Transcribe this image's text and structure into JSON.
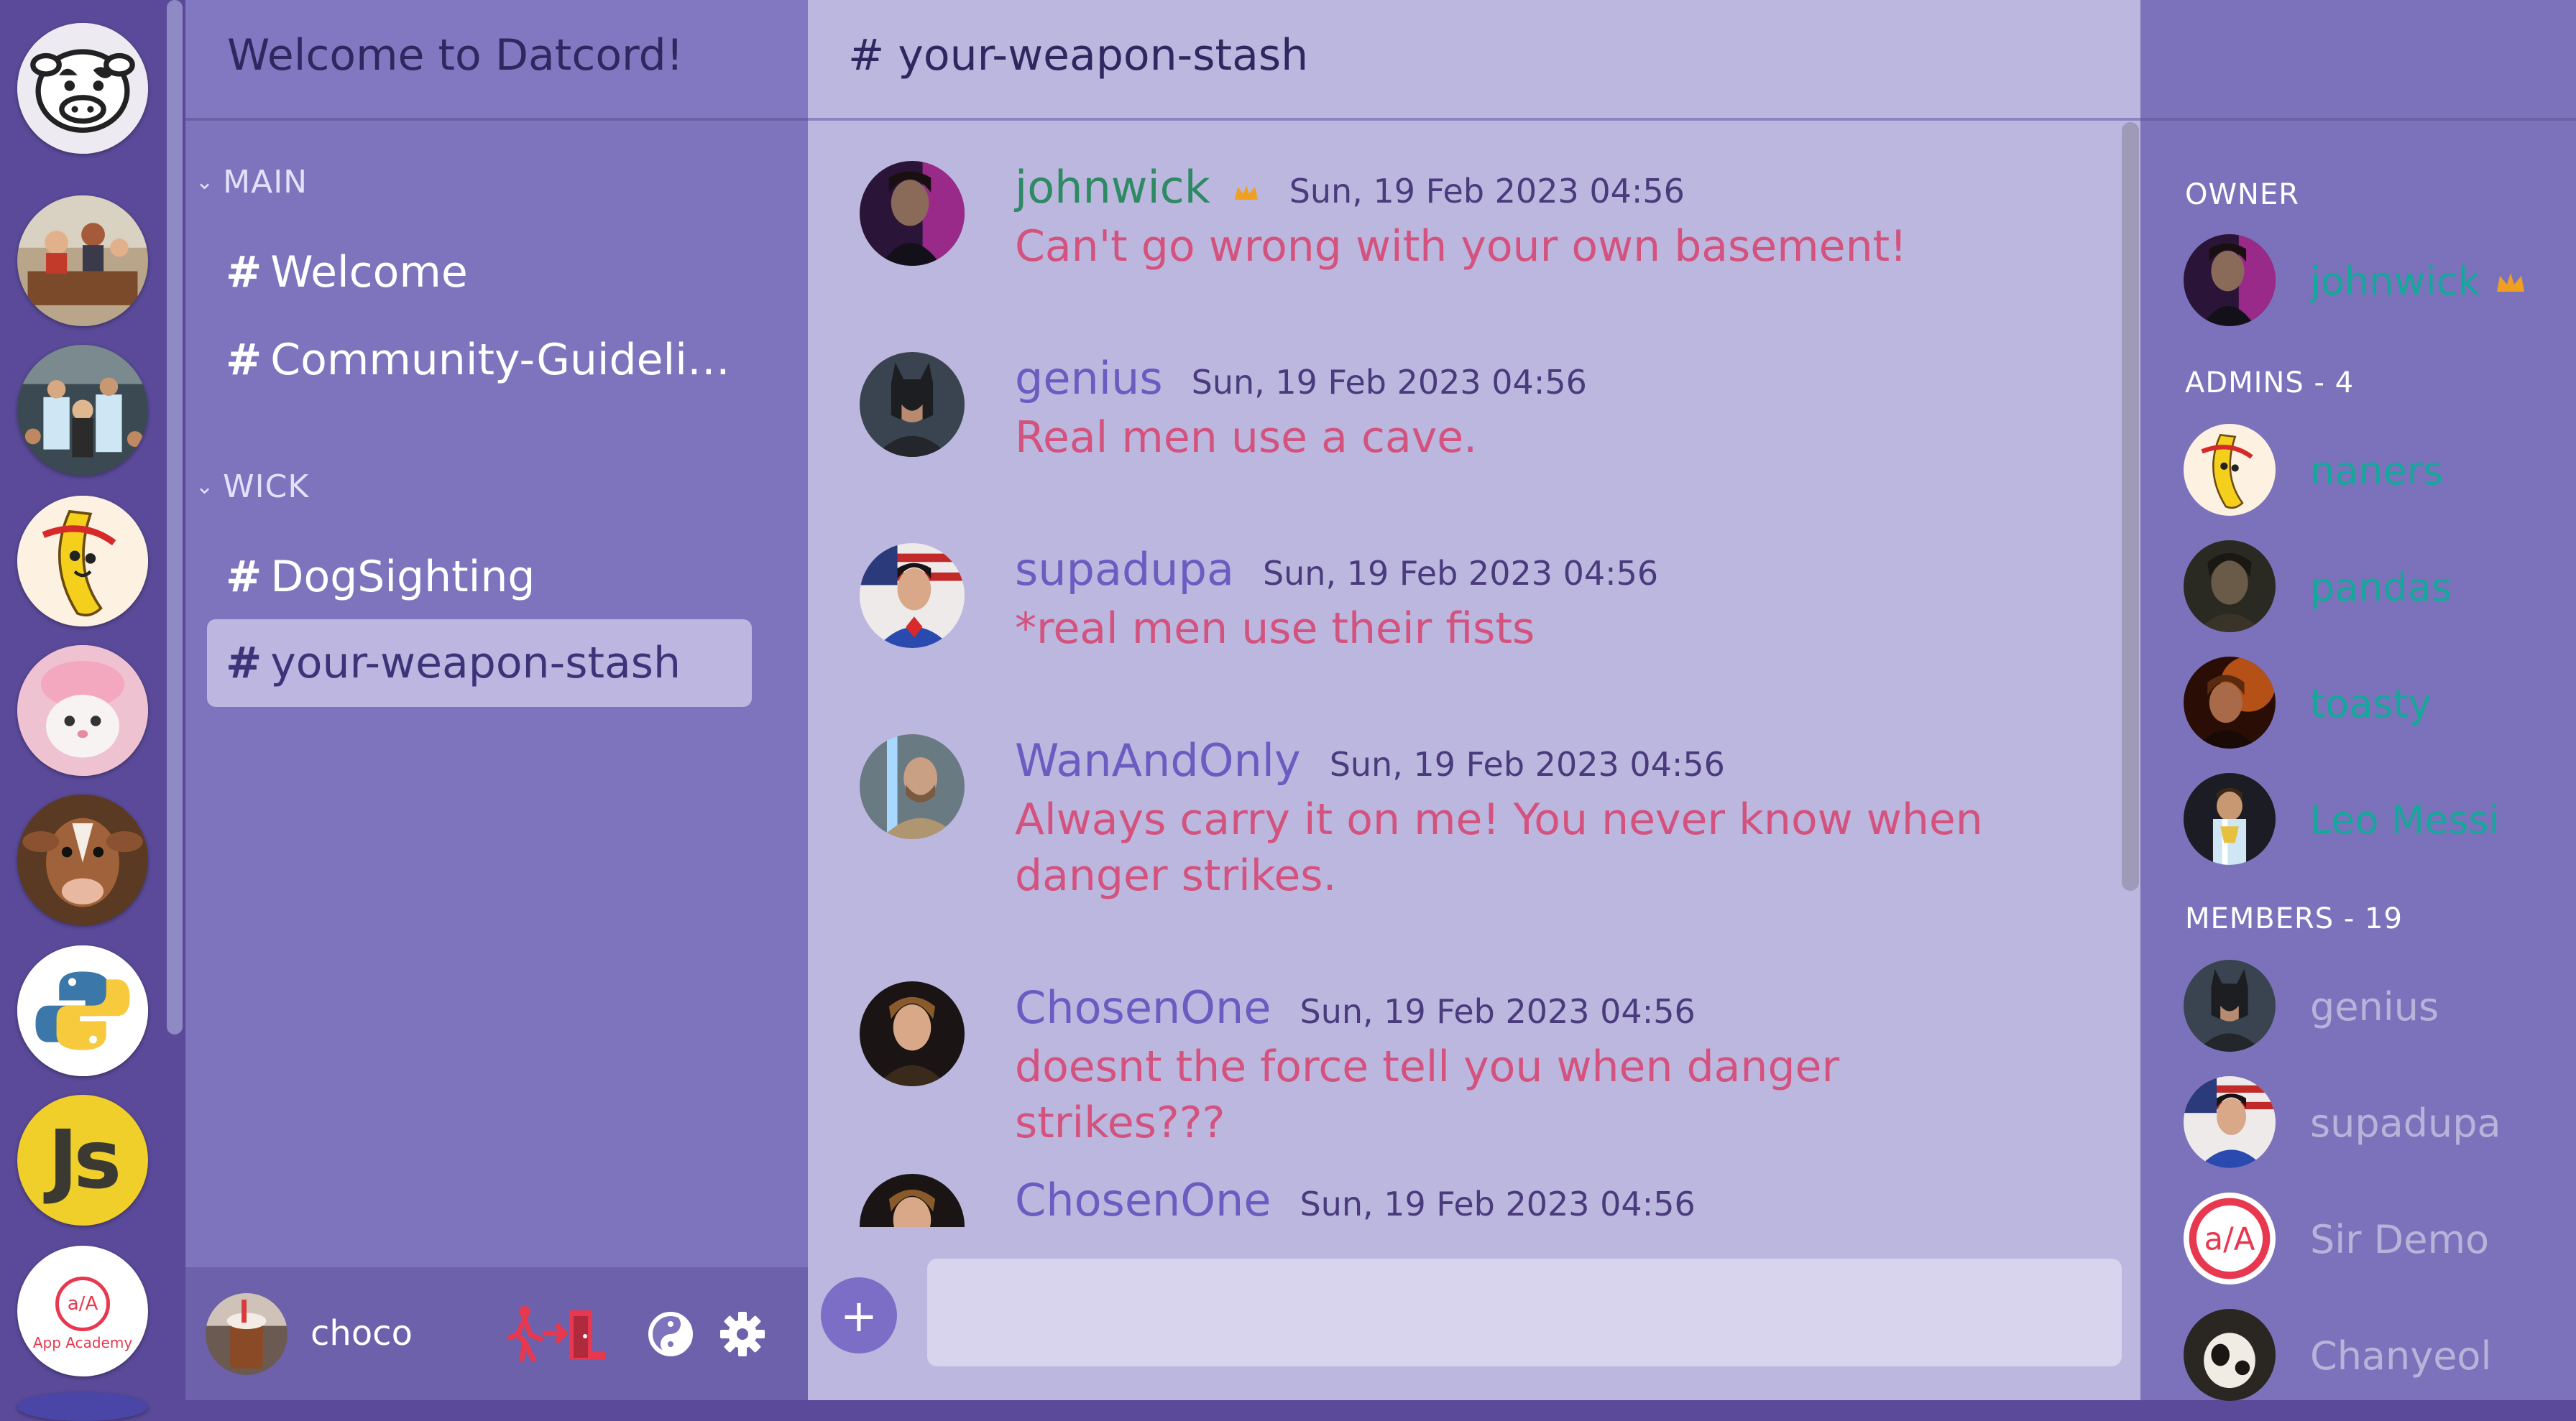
{
  "app": {
    "welcome_title": "Welcome to Datcord!"
  },
  "servers": [
    {
      "name": "home-cow-icon"
    },
    {
      "name": "office-party"
    },
    {
      "name": "soccer-crowd"
    },
    {
      "name": "banana-character"
    },
    {
      "name": "pink-cat"
    },
    {
      "name": "cow-photo"
    },
    {
      "name": "python-logo"
    },
    {
      "name": "js-logo",
      "label": "Js"
    },
    {
      "name": "app-academy-logo",
      "label_top": "a/A",
      "label_bottom": "App Academy"
    }
  ],
  "sidebar": {
    "categories": [
      {
        "label": "MAIN",
        "channels": [
          "Welcome",
          "Community-Guidelin..."
        ]
      },
      {
        "label": "WICK",
        "channels": [
          "DogSighting",
          "your-weapon-stash"
        ]
      }
    ],
    "active_channel": "your-weapon-stash",
    "hash": "#"
  },
  "current_user": {
    "name": "choco"
  },
  "chat": {
    "channel_title": "# your-weapon-stash",
    "add_label": "+",
    "messages": [
      {
        "author": "johnwick",
        "time": "Sun, 19 Feb 2023 04:56",
        "text": "Can't go wrong with your own basement!",
        "owner": true
      },
      {
        "author": "genius",
        "time": "Sun, 19 Feb 2023 04:56",
        "text": "Real men use a cave."
      },
      {
        "author": "supadupa",
        "time": "Sun, 19 Feb 2023 04:56",
        "text": "*real men use their fists"
      },
      {
        "author": "WanAndOnly",
        "time": "Sun, 19 Feb 2023 04:56",
        "text": "Always carry it on me! You never know when danger strikes."
      },
      {
        "author": "ChosenOne",
        "time": "Sun, 19 Feb 2023 04:56",
        "text": "doesnt the force tell you when danger strikes???"
      },
      {
        "author": "ChosenOne",
        "time": "Sun, 19 Feb 2023 04:56",
        "text": ""
      }
    ]
  },
  "members": {
    "owner_title": "OWNER",
    "owner": {
      "name": "johnwick"
    },
    "admins_title": "ADMINS - 4",
    "admins": [
      {
        "name": "naners"
      },
      {
        "name": "pandas"
      },
      {
        "name": "toasty"
      },
      {
        "name": "Leo Messi"
      }
    ],
    "members_title": "MEMBERS - 19",
    "members": [
      {
        "name": "genius"
      },
      {
        "name": "supadupa"
      },
      {
        "name": "Sir Demo"
      },
      {
        "name": "Chanyeol"
      }
    ]
  },
  "colors": {
    "rail_bg": "#5a4a99",
    "sidebar_bg": "#7e74bd",
    "chat_bg": "#bcb7df",
    "message_text": "#d4527e",
    "author": "#6a5cc0",
    "staff_name": "#15a89a",
    "crown": "#f0a020",
    "leave_icon": "#e8384f"
  }
}
